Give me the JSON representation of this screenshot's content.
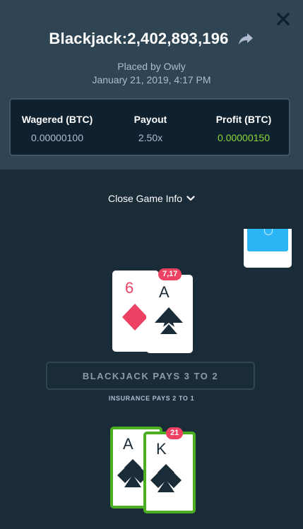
{
  "header": {
    "title": "Blackjack:2,402,893,196",
    "placed_by": "Placed by Owly",
    "date": "January 21, 2019, 4:17 PM"
  },
  "stats": {
    "wagered_label": "Wagered (BTC)",
    "wagered_value": "0.00000100",
    "payout_label": "Payout",
    "payout_value": "2.50x",
    "profit_label": "Profit (BTC)",
    "profit_value": "0.00000150"
  },
  "toggle": {
    "label": "Close Game Info"
  },
  "dealer": {
    "score": "7,17",
    "cards": [
      {
        "rank": "6",
        "suit": "diamond",
        "color": "#ed4163"
      },
      {
        "rank": "A",
        "suit": "spade",
        "color": "#1a2c38"
      }
    ]
  },
  "table": {
    "pays_text": "BLACKJACK PAYS 3 TO 2",
    "insurance_text": "INSURANCE PAYS 2 TO 1"
  },
  "player": {
    "score": "21",
    "cards": [
      {
        "rank": "A",
        "suit": "club",
        "color": "#1a2c38"
      },
      {
        "rank": "K",
        "suit": "club",
        "color": "#1a2c38"
      }
    ]
  },
  "colors": {
    "panel": "#2f4553",
    "background": "#1a2c38",
    "profit_green": "#8cd637",
    "badge_red": "#ed4163",
    "win_border": "#4cae23",
    "deck_blue": "#2bb5f5"
  },
  "icons": [
    "close-icon",
    "share-icon",
    "chevron-down-icon",
    "diamond-suit-icon",
    "spade-suit-icon",
    "club-suit-icon"
  ]
}
